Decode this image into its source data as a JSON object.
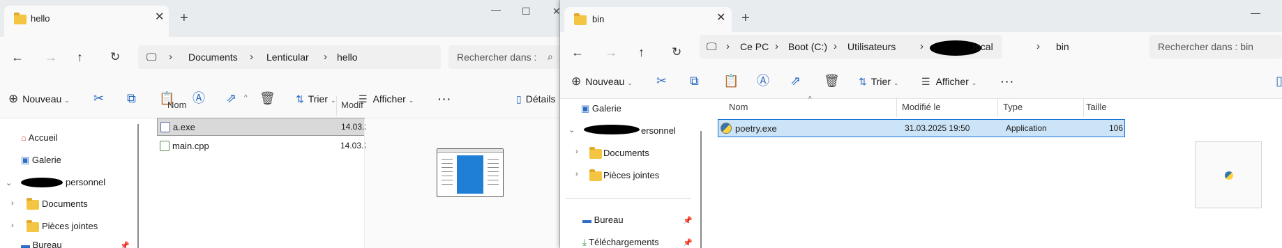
{
  "win1": {
    "tab_title": "hello",
    "breadcrumb": [
      "Documents",
      "Lenticular",
      "hello"
    ],
    "search_placeholder": "Rechercher dans :",
    "toolbar": {
      "new_label": "Nouveau",
      "sort_label": "Trier",
      "view_label": "Afficher",
      "details_label": "Détails"
    },
    "nav": {
      "home": "Accueil",
      "gallery": "Galerie",
      "onedrive_suffix": "personnel",
      "documents": "Documents",
      "attachments": "Pièces jointes",
      "desktop": "Bureau"
    },
    "columns": {
      "name": "Nom",
      "modified": "Modif"
    },
    "files": [
      {
        "name": "a.exe",
        "modified": "14.03.2"
      },
      {
        "name": "main.cpp",
        "modified": "14.03.2"
      }
    ]
  },
  "win2": {
    "tab_title": "bin",
    "breadcrumb": [
      "Ce PC",
      "Boot (C:)",
      "Utilisateurs",
      ".local",
      "bin"
    ],
    "search_placeholder": "Rechercher dans : bin",
    "toolbar": {
      "new_label": "Nouveau",
      "sort_label": "Trier",
      "view_label": "Afficher"
    },
    "nav": {
      "gallery": "Galerie",
      "onedrive_suffix": "ersonnel",
      "documents": "Documents",
      "attachments": "Pièces jointes",
      "desktop": "Bureau",
      "downloads": "Téléchargements"
    },
    "columns": {
      "name": "Nom",
      "modified": "Modifié le",
      "type": "Type",
      "size": "Taille"
    },
    "files": [
      {
        "name": "poetry.exe",
        "modified": "31.03.2025 19:50",
        "type": "Application",
        "size": "106"
      }
    ]
  },
  "icons": {
    "back": "arrow-left-icon",
    "forward": "arrow-right-icon",
    "up": "arrow-up-icon",
    "refresh": "refresh-icon",
    "computer": "monitor-icon",
    "cut": "scissors-icon",
    "copy": "copy-icon",
    "paste": "paste-icon",
    "rename": "rename-icon",
    "share": "share-icon",
    "delete": "trash-icon",
    "more": "more-icon"
  },
  "colors": {
    "accent": "#2b6cc4",
    "selection_blue": "#cce4f7",
    "selection_gray": "#d9d9d9",
    "folder": "#f4c542"
  }
}
